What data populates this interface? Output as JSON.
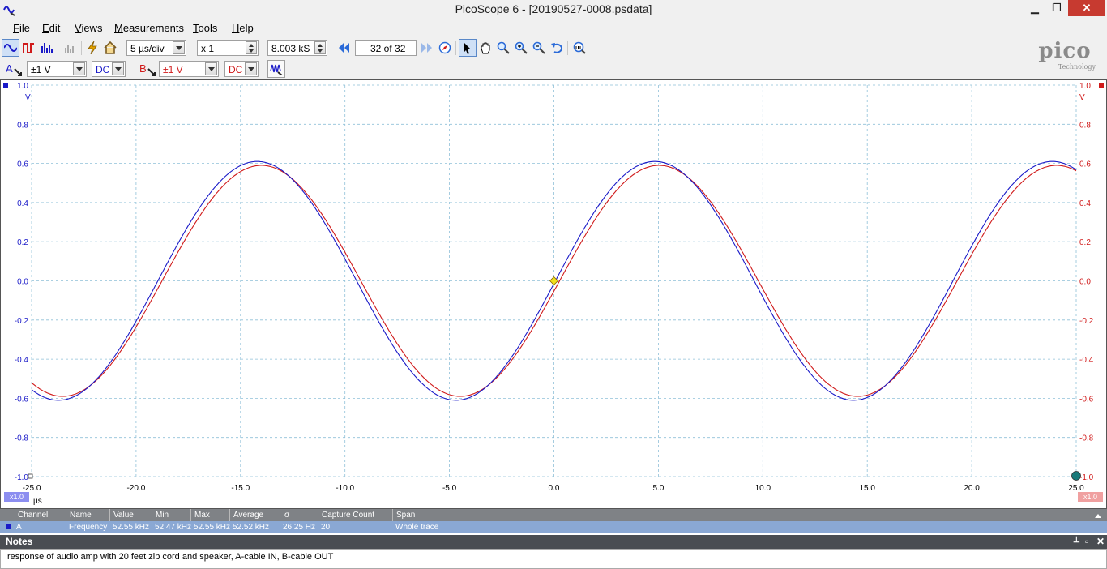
{
  "window": {
    "title": "PicoScope 6 - [20190527-0008.psdata]",
    "buttons": {
      "minimize": "▁",
      "maximize": "❐",
      "close": "✕"
    }
  },
  "menu": {
    "items": [
      {
        "first": "F",
        "rest": "ile"
      },
      {
        "first": "E",
        "rest": "dit"
      },
      {
        "first": "V",
        "rest": "iews"
      },
      {
        "first": "M",
        "rest": "easurements"
      },
      {
        "first": "T",
        "rest": "ools"
      },
      {
        "first": "H",
        "rest": "elp"
      }
    ]
  },
  "toolbar": {
    "timebase": "5 µs/div",
    "zoom": "x 1",
    "samples": "8.003 kS",
    "buffer": "32 of 32"
  },
  "channels": {
    "a": {
      "label": "A",
      "range": "±1 V",
      "coupling": "DC",
      "color": "#1a1ac8"
    },
    "b": {
      "label": "B",
      "range": "±1 V",
      "coupling": "DC",
      "color": "#d01a1a"
    }
  },
  "logo": {
    "word": "pico",
    "sub": "Technology"
  },
  "scope": {
    "y_unit_left": "V",
    "y_unit_right": "V",
    "x_unit": "µs",
    "scale_left": "x1.0",
    "scale_right": "x1.0",
    "x_ticks": [
      "-25.0",
      "-20.0",
      "-15.0",
      "-10.0",
      "-5.0",
      "0.0",
      "5.0",
      "10.0",
      "15.0",
      "20.0",
      "25.0"
    ],
    "y_ticks": [
      "1.0",
      "0.8",
      "0.6",
      "0.4",
      "0.2",
      "0.0",
      "-0.2",
      "-0.4",
      "-0.6",
      "-0.8",
      "-1.0"
    ]
  },
  "chart_data": {
    "type": "line",
    "xlim": [
      -25,
      25
    ],
    "ylim": [
      -1,
      1
    ],
    "grid": true,
    "series": [
      {
        "name": "A",
        "color": "#1a1ac8",
        "amplitude": 0.61,
        "frequency_khz": 52.55,
        "peak_x_us": -14.2
      },
      {
        "name": "B",
        "color": "#d01a1a",
        "amplitude": 0.59,
        "frequency_khz": 52.55,
        "peak_x_us": -14.0
      }
    ],
    "trigger": {
      "x": 0.0,
      "y": 0.0
    }
  },
  "measurements": {
    "headers": [
      "Channel",
      "Name",
      "Value",
      "Min",
      "Max",
      "Average",
      "σ",
      "Capture Count",
      "Span"
    ],
    "rows": [
      [
        "A",
        "Frequency",
        "52.55 kHz",
        "52.47 kHz",
        "52.55 kHz",
        "52.52 kHz",
        "26.25 Hz",
        "20",
        "Whole trace"
      ]
    ]
  },
  "notes": {
    "title": "Notes",
    "text": "response of audio amp with 20 feet zip cord and speaker, A-cable IN, B-cable OUT",
    "pin": "📌",
    "close": "✕"
  }
}
